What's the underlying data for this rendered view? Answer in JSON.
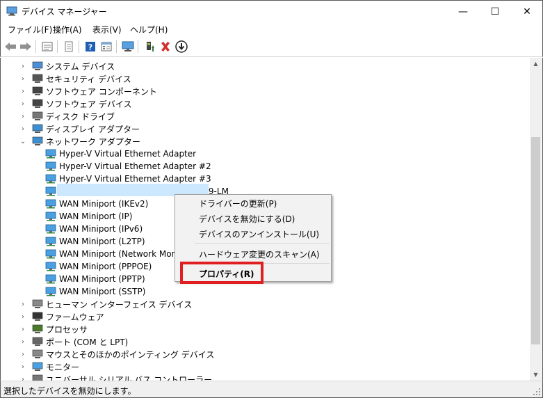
{
  "window": {
    "title": "デバイス マネージャー",
    "minimize_glyph": "—",
    "maximize_glyph": "☐",
    "close_glyph": "✕"
  },
  "menu": [
    "ファイル(F)",
    "操作(A)",
    "表示(V)",
    "ヘルプ(H)"
  ],
  "toolbar": {
    "buttons": [
      "back-icon",
      "forward-icon",
      "properties-icon",
      "print-icon",
      "help-icon",
      "details-icon",
      "monitor-icon",
      "update-driver-icon",
      "uninstall-icon",
      "disable-icon"
    ],
    "accent": "#2e7d32",
    "danger": "#d32f2f"
  },
  "tree": {
    "expand_glyph": "›",
    "collapse_glyph": "⌄",
    "categories_top": [
      {
        "label": "システム デバイス",
        "icon": "system-icon"
      },
      {
        "label": "セキュリティ デバイス",
        "icon": "security-icon"
      },
      {
        "label": "ソフトウェア コンポーネント",
        "icon": "software-component-icon"
      },
      {
        "label": "ソフトウェア デバイス",
        "icon": "software-device-icon"
      },
      {
        "label": "ディスク ドライブ",
        "icon": "disk-icon"
      },
      {
        "label": "ディスプレイ アダプター",
        "icon": "display-icon"
      }
    ],
    "network_category": "ネットワーク アダプター",
    "network_children": [
      "Hyper-V Virtual Ethernet Adapter",
      "Hyper-V Virtual Ethernet Adapter #2",
      "Hyper-V Virtual Ethernet Adapter #3",
      "Intel(R) Ethernet Connection (7) I219-LM",
      "WAN Miniport (IKEv2)",
      "WAN Miniport (IP)",
      "WAN Miniport (IPv6)",
      "WAN Miniport (L2TP)",
      "WAN Miniport (Network Monitor)",
      "WAN Miniport (PPPOE)",
      "WAN Miniport (PPTP)",
      "WAN Miniport (SSTP)"
    ],
    "categories_bottom": [
      {
        "label": "ヒューマン インターフェイス デバイス",
        "icon": "hid-icon"
      },
      {
        "label": "ファームウェア",
        "icon": "firmware-icon"
      },
      {
        "label": "プロセッサ",
        "icon": "processor-icon"
      },
      {
        "label": "ポート (COM と LPT)",
        "icon": "port-icon"
      },
      {
        "label": "マウスとそのほかのポインティング デバイス",
        "icon": "mouse-icon"
      },
      {
        "label": "モニター",
        "icon": "monitor-icon"
      },
      {
        "label": "ユニバーサル シリアル バス コントローラー",
        "icon": "usb-icon"
      }
    ]
  },
  "context_menu": {
    "items": [
      "ドライバーの更新(P)",
      "デバイスを無効にする(D)",
      "デバイスのアンインストール(U)",
      "ハードウェア変更のスキャン(A)",
      "プロパティ(R)"
    ],
    "highlight_color": "#e02020"
  },
  "status": "選択したデバイスを無効にします。"
}
